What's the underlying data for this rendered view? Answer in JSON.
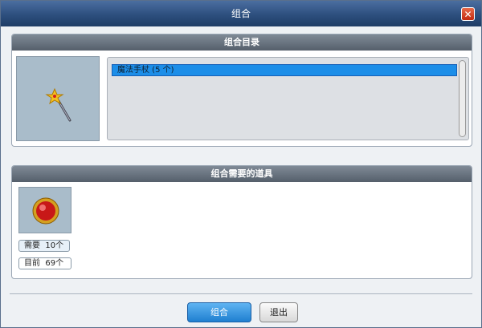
{
  "window": {
    "title": "组合"
  },
  "catalog": {
    "header": "组合目录",
    "items": [
      {
        "label": "魔法手杖 (5 个)"
      }
    ],
    "selected_item_icon": "magic-wand-icon"
  },
  "requirements": {
    "header": "组合需要的道具",
    "item_icon": "red-orb-icon",
    "needed_label": "需要",
    "needed_value": "10个",
    "current_label": "目前",
    "current_value": "69个"
  },
  "buttons": {
    "combine": "组合",
    "exit": "退出"
  },
  "colors": {
    "title_bar": "#2d4f7e",
    "selection": "#1c8ee8",
    "primary_button": "#1f7fd0"
  }
}
